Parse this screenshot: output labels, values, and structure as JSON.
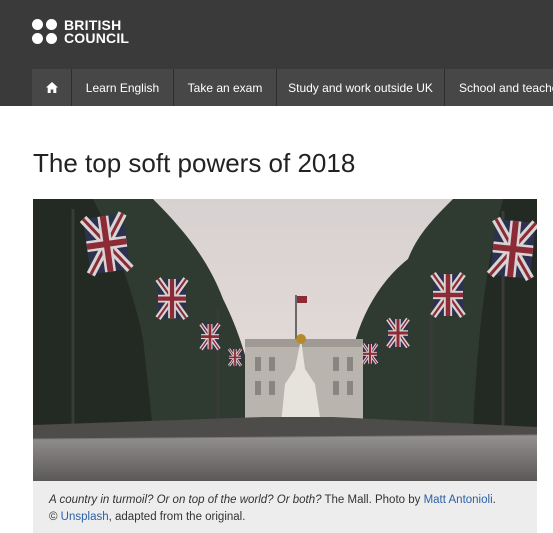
{
  "header": {
    "logo": {
      "line1": "BRITISH",
      "line2": "COUNCIL"
    },
    "nav": [
      {
        "label": "Learn English"
      },
      {
        "label": "Take an exam"
      },
      {
        "label": "Study and work outside UK"
      },
      {
        "label": "School and teacher"
      }
    ],
    "home_icon": "home-icon",
    "background": "#3a3a3a"
  },
  "article": {
    "title": "The top soft powers of 2018",
    "caption": {
      "italic": "A country in turmoil? Or on top of the world? Or both?",
      "text1": " The Mall. Photo by ",
      "author": "Matt Antonioli",
      "text2": ".",
      "text3": " © ",
      "source": "Unsplash",
      "text4": ", adapted from the original."
    }
  }
}
